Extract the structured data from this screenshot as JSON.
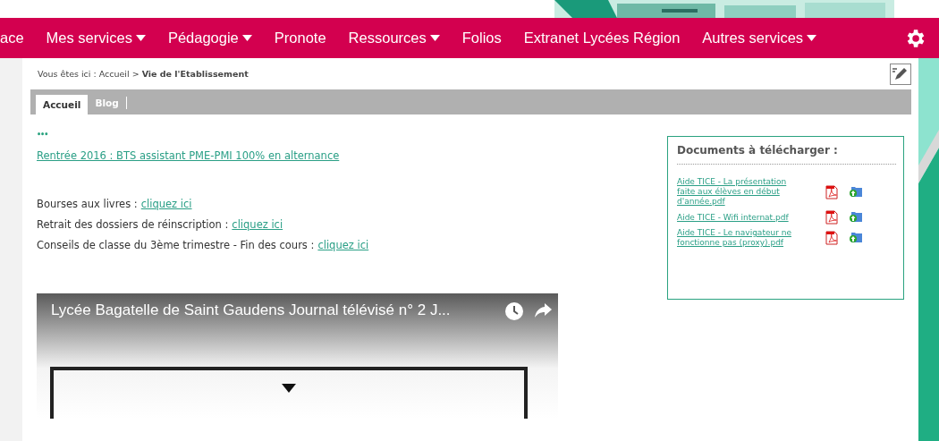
{
  "nav": {
    "items": [
      {
        "label": "ace",
        "dropdown": false
      },
      {
        "label": "Mes services",
        "dropdown": true
      },
      {
        "label": "Pédagogie",
        "dropdown": true
      },
      {
        "label": "Pronote",
        "dropdown": false
      },
      {
        "label": "Ressources",
        "dropdown": true
      },
      {
        "label": "Folios",
        "dropdown": false
      },
      {
        "label": "Extranet Lycées Région",
        "dropdown": false
      },
      {
        "label": "Autres services",
        "dropdown": true
      }
    ]
  },
  "breadcrumb": {
    "prefix": "Vous êtes ici : Accueil >",
    "current": "Vie de l'Etablissement"
  },
  "tabs": [
    {
      "label": "Accueil",
      "selected": true
    },
    {
      "label": "Blog",
      "selected": false
    }
  ],
  "content": {
    "ellipsis": "•••",
    "headline_link": "Rentrée 2016 : BTS assistant PME-PMI 100% en alternance",
    "lines": [
      {
        "text": "Bourses aux livres :",
        "link": "cliquez ici"
      },
      {
        "text": "Retrait des dossiers de réinscription :",
        "link": "cliquez ici"
      },
      {
        "text": "Conseils de classe du 3ème trimestre - Fin des cours :",
        "link": "cliquez ici"
      }
    ],
    "video": {
      "title": "Lycée Bagatelle de Saint Gaudens Journal télévisé n° 2 J..."
    }
  },
  "documents": {
    "title": "Documents à télécharger :",
    "items": [
      {
        "label": "Aide TICE - La présentation faite aux élèves en début d'année.pdf"
      },
      {
        "label": "Aide TICE - Wifi internat.pdf"
      },
      {
        "label": "Aide TICE - Le navigateur ne fonctionne pas (proxy).pdf"
      }
    ]
  }
}
